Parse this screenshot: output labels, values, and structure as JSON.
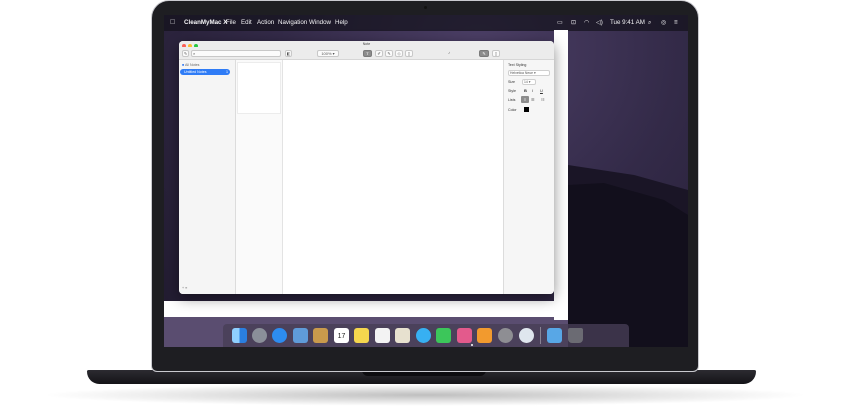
{
  "menubar": {
    "apple_icon": "apple-icon",
    "app_name": "CleanMyMac X",
    "menus": [
      "File",
      "Edit",
      "Action",
      "Navigation",
      "Window",
      "Help"
    ],
    "clock": "Tue 9:41 AM",
    "status_icons": [
      "airplay-icon",
      "wifi-icon",
      "volume-icon",
      "search-icon",
      "menu-icon"
    ]
  },
  "window": {
    "title": "Note",
    "zoom": "100%",
    "sidebar": {
      "header": "All Notes",
      "items": [
        {
          "label": "Untitled Notes",
          "count": "1"
        }
      ],
      "footer": "+ ≡"
    },
    "inspector": {
      "title": "Text Styling",
      "font": "Helvetica Neue",
      "size_label": "Size",
      "size_value": "14",
      "style_label": "Style",
      "style_buttons": [
        "B",
        "I",
        "U"
      ],
      "lists_label": "Lists",
      "color_label": "Color",
      "color_value": "#000000"
    }
  },
  "dock": {
    "apps": [
      {
        "name": "finder-icon",
        "color": "#3a8ee6"
      },
      {
        "name": "launchpad-icon",
        "color": "#8a8f99"
      },
      {
        "name": "safari-icon",
        "color": "#2d8cf0"
      },
      {
        "name": "photo-preview-icon",
        "color": "#5f9bd9"
      },
      {
        "name": "notes-book-icon",
        "color": "#c99a4c"
      },
      {
        "name": "calendar-icon",
        "color": "#ffffff"
      },
      {
        "name": "notes-icon",
        "color": "#f5d64e"
      },
      {
        "name": "reminders-icon",
        "color": "#f3f3f3"
      },
      {
        "name": "preview-icon",
        "color": "#e7e1cf"
      },
      {
        "name": "messages-icon",
        "color": "#37b0f2"
      },
      {
        "name": "facetime-icon",
        "color": "#3cc65a"
      },
      {
        "name": "photo-booth-icon",
        "color": "#e35a8c"
      },
      {
        "name": "books-icon",
        "color": "#f29a2e"
      },
      {
        "name": "system-preferences-icon",
        "color": "#8e8e93"
      },
      {
        "name": "cleanmymac-icon",
        "color": "#dfe6ee"
      },
      {
        "name": "folder-icon",
        "color": "#58a7e6"
      },
      {
        "name": "trash-icon",
        "color": "#6b6b73"
      }
    ],
    "calendar_day": "17"
  }
}
